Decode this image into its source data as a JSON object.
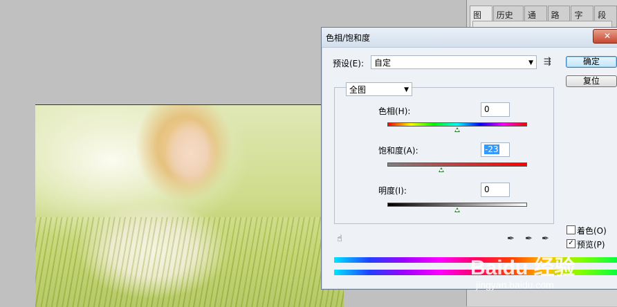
{
  "panel": {
    "tabs": [
      "图层",
      "历史记",
      "通道",
      "路径",
      "字符",
      "段落"
    ]
  },
  "dialog": {
    "title": "色相/饱和度",
    "close_label": "✕",
    "preset_label": "预设(E):",
    "preset_value": "自定",
    "ok_label": "确定",
    "reset_label": "复位",
    "channel_value": "全图",
    "hue": {
      "label": "色相(H):",
      "value": "0",
      "level": 0.5
    },
    "saturation": {
      "label": "饱和度(A):",
      "value": "-23",
      "level": 0.385
    },
    "lightness": {
      "label": "明度(I):",
      "value": "0",
      "level": 0.5
    },
    "colorize": {
      "label": "着色(O)",
      "checked": false
    },
    "preview": {
      "label": "预览(P)",
      "checked": true
    },
    "icons": [
      "preset-options-icon",
      "hand-adjust-icon",
      "eyedropper-icon",
      "eyedropper-plus-icon",
      "eyedropper-minus-icon"
    ]
  },
  "watermark": {
    "brand": "Baidu 经验",
    "url": "jingyan.baidu.com"
  }
}
